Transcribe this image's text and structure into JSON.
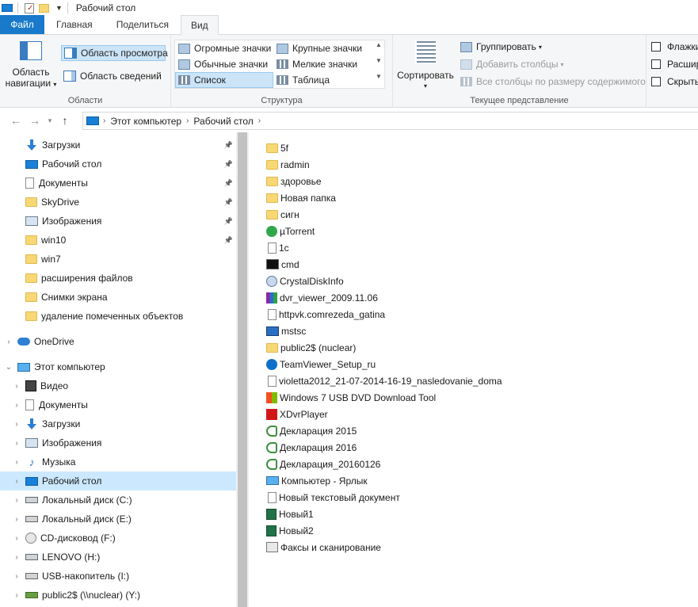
{
  "window": {
    "title": "Рабочий стол"
  },
  "tabs": [
    {
      "label": "Файл"
    },
    {
      "label": "Главная"
    },
    {
      "label": "Поделиться"
    },
    {
      "label": "Вид"
    }
  ],
  "ribbon": {
    "panes": {
      "label": "Области",
      "nav_pane_line1": "Область",
      "nav_pane_line2": "навигации",
      "preview_pane": "Область просмотра",
      "details_pane": "Область сведений"
    },
    "layout": {
      "label": "Структура",
      "huge_icons": "Огромные значки",
      "large_icons": "Крупные значки",
      "normal_icons": "Обычные значки",
      "small_icons": "Мелкие значки",
      "list": "Список",
      "table": "Таблица"
    },
    "current_view": {
      "label": "Текущее представление",
      "sort": "Сортировать",
      "group": "Группировать",
      "add_columns": "Добавить столбцы",
      "fit_columns": "Все столбцы по размеру содержимого"
    },
    "show_hide": {
      "checkbox1": "Флажки",
      "checkbox2": "Расшир",
      "checkbox3": "Скрыть"
    }
  },
  "address": {
    "crumbs": [
      "Этот компьютер",
      "Рабочий стол"
    ]
  },
  "nav_pane": {
    "quick_access": [
      {
        "label": "Загрузки",
        "icon": "download-icon",
        "pinned": true
      },
      {
        "label": "Рабочий стол",
        "icon": "desktop-icon",
        "pinned": true
      },
      {
        "label": "Документы",
        "icon": "documents-icon",
        "pinned": true
      },
      {
        "label": "SkyDrive",
        "icon": "folder-icon",
        "pinned": true
      },
      {
        "label": "Изображения",
        "icon": "pictures-icon",
        "pinned": true
      },
      {
        "label": "win10",
        "icon": "folder-icon",
        "pinned": true
      },
      {
        "label": "win7",
        "icon": "folder-icon",
        "pinned": false
      },
      {
        "label": "расширения файлов",
        "icon": "folder-icon",
        "pinned": false
      },
      {
        "label": "Снимки экрана",
        "icon": "folder-icon",
        "pinned": false
      },
      {
        "label": "удаление помеченных объектов",
        "icon": "folder-icon",
        "pinned": false
      }
    ],
    "onedrive": "OneDrive",
    "this_pc": "Этот компьютер",
    "pc_items": [
      {
        "label": "Видео",
        "icon": "video-icon"
      },
      {
        "label": "Документы",
        "icon": "documents-icon"
      },
      {
        "label": "Загрузки",
        "icon": "download-icon"
      },
      {
        "label": "Изображения",
        "icon": "pictures-icon"
      },
      {
        "label": "Музыка",
        "icon": "music-icon"
      },
      {
        "label": "Рабочий стол",
        "icon": "desktop-icon",
        "selected": true
      },
      {
        "label": "Локальный диск (C:)",
        "icon": "drive-icon"
      },
      {
        "label": "Локальный диск (E:)",
        "icon": "drive-icon"
      },
      {
        "label": "CD-дисковод (F:)",
        "icon": "cd-icon"
      },
      {
        "label": "LENOVO (H:)",
        "icon": "drive-icon"
      },
      {
        "label": "USB-накопитель (I:)",
        "icon": "drive-icon"
      },
      {
        "label": "public2$ (\\\\nuclear) (Y:)",
        "icon": "network-drive-icon"
      }
    ]
  },
  "files": [
    {
      "name": "5f",
      "icon": "folder-icon"
    },
    {
      "name": "radmin",
      "icon": "folder-icon"
    },
    {
      "name": "здоровье",
      "icon": "folder-icon"
    },
    {
      "name": "Новая папка",
      "icon": "folder-icon"
    },
    {
      "name": "сигн",
      "icon": "folder-icon"
    },
    {
      "name": "µTorrent",
      "icon": "utorrent-icon"
    },
    {
      "name": "1c",
      "icon": "document-icon"
    },
    {
      "name": "cmd",
      "icon": "cmd-icon"
    },
    {
      "name": "CrystalDiskInfo",
      "icon": "crystaldisk-icon"
    },
    {
      "name": "dvr_viewer_2009.11.06",
      "icon": "archive-icon"
    },
    {
      "name": "httpvk.comrezeda_gatina",
      "icon": "document-icon"
    },
    {
      "name": "mstsc",
      "icon": "remote-desktop-icon"
    },
    {
      "name": "public2$ (nuclear)",
      "icon": "network-folder-icon"
    },
    {
      "name": "TeamViewer_Setup_ru",
      "icon": "teamviewer-icon"
    },
    {
      "name": "violetta2012_21-07-2014-16-19_nasledovanie_doma",
      "icon": "document-icon"
    },
    {
      "name": "Windows 7 USB DVD Download Tool",
      "icon": "windows-icon"
    },
    {
      "name": "XDvrPlayer",
      "icon": "player-icon"
    },
    {
      "name": "Декларация 2015",
      "icon": "declaration-icon"
    },
    {
      "name": "Декларация 2016",
      "icon": "declaration-icon"
    },
    {
      "name": "Декларация_20160126",
      "icon": "declaration-icon"
    },
    {
      "name": "Компьютер - Ярлык",
      "icon": "computer-shortcut-icon"
    },
    {
      "name": "Новый текстовый документ",
      "icon": "document-icon"
    },
    {
      "name": "Новый1",
      "icon": "excel-icon"
    },
    {
      "name": "Новый2",
      "icon": "excel-icon"
    },
    {
      "name": "Факсы и сканирование",
      "icon": "fax-icon"
    }
  ]
}
